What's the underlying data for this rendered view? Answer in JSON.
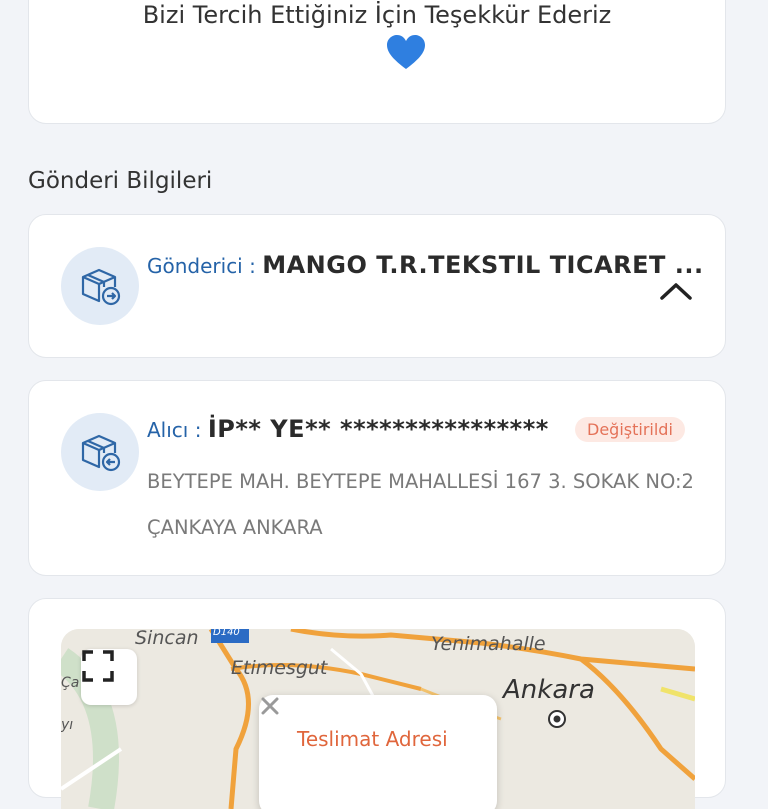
{
  "thanks": {
    "text": "Bizi Tercih Ettiğiniz İçin Teşekkür Ederiz",
    "emoji": "heart-icon"
  },
  "section": {
    "title": "Gönderi Bilgileri"
  },
  "sender": {
    "label": "Gönderici : ",
    "name": "MANGO T.R.TEKSTIL TICARET ...",
    "icon": "package-outgoing-icon",
    "toggle_icon": "chevron-up-icon"
  },
  "receiver": {
    "label": "Alıcı : ",
    "name": "İP** YE** ****************",
    "badge": "Değiştirildi",
    "address": "BEYTEPE MAH. BEYTEPE MAHALLESİ 167 3. SOKAK NO:2 ÇANKAYA ANKARA",
    "icon": "package-incoming-icon"
  },
  "map": {
    "labels": {
      "sincan": "Sincan",
      "road": "D140",
      "yenimahalle": "Yenimahalle",
      "etimesgut": "Etimesgut",
      "ankara": "Ankara",
      "ca": "Ça",
      "yi": "yı"
    },
    "popup_title": "Teslimat Adresi",
    "fullscreen_icon": "fullscreen-icon",
    "close_icon": "close-icon"
  },
  "colors": {
    "accent_blue": "#2563a8",
    "badge_red": "#e05a3c",
    "road_orange": "#f0a23c",
    "heart": "#2f7fe0"
  }
}
